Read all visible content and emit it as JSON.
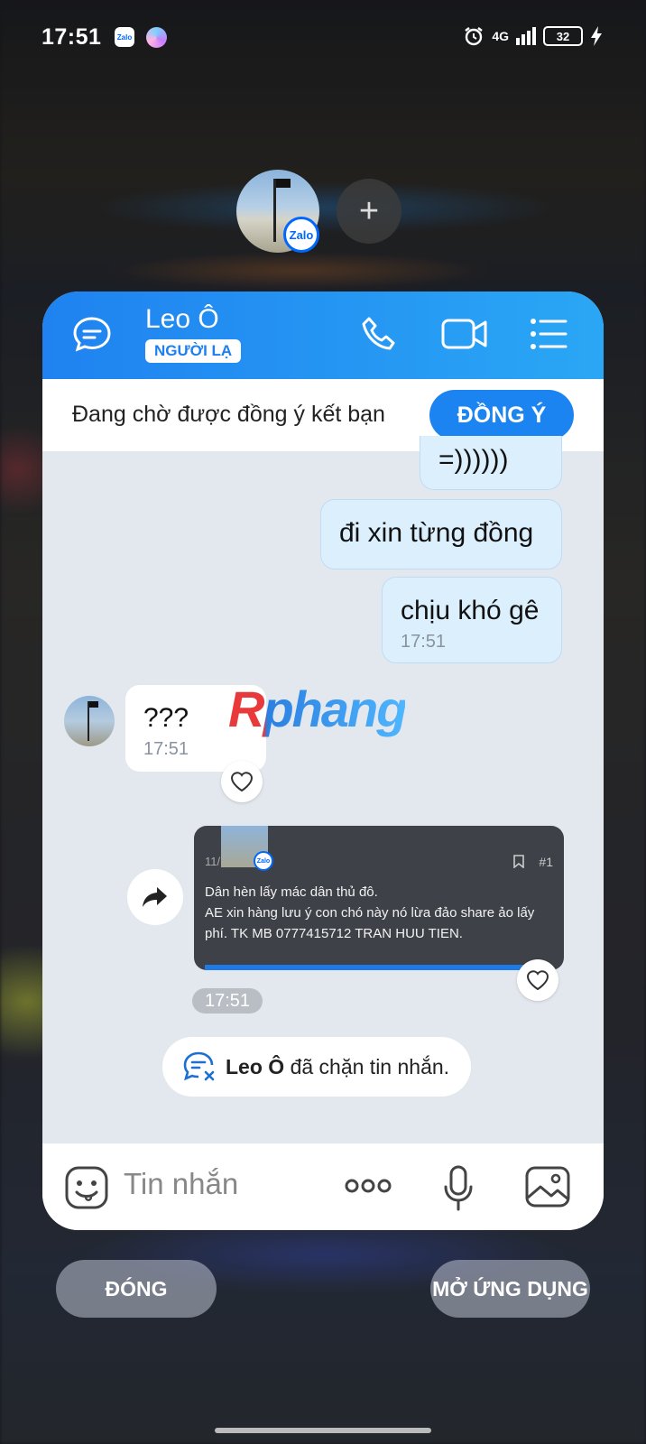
{
  "status": {
    "time": "17:51",
    "zalo_icon": "Zalo",
    "network": "4G",
    "battery": "32"
  },
  "bubble": {
    "zalo_badge": "Zalo",
    "add": "+"
  },
  "header": {
    "name": "Leo Ô",
    "badge": "NGƯỜI LẠ"
  },
  "friend_request": {
    "text": "Đang chờ được đồng ý kết bạn",
    "accept_label": "ĐỒNG Ý"
  },
  "messages": [
    {
      "from": "me",
      "text": "=))))))"
    },
    {
      "from": "me",
      "text": "đi xin từng đồng"
    },
    {
      "from": "me",
      "text": "chịu khó gê",
      "time": "17:51"
    },
    {
      "from": "peer",
      "text": "???",
      "time": "17:51"
    }
  ],
  "watermark": "Rphang",
  "shared_card": {
    "date": "11/",
    "badge": "Zalo",
    "number": "#1",
    "lines": [
      "Dân hèn lấy mác dân thủ đô.",
      "AE xin hàng lưu ý con chó này nó lừa đảo share ảo lấy",
      "phí. TK MB 0777415712 TRAN HUU TIEN."
    ],
    "time": "17:51"
  },
  "blocked_notice": {
    "name": "Leo Ô",
    "text": "đã chặn tin nhắn."
  },
  "input": {
    "placeholder": "Tin nhắn"
  },
  "footer": {
    "close_label": "ĐÓNG",
    "open_label": "MỞ ỨNG DỤNG"
  }
}
